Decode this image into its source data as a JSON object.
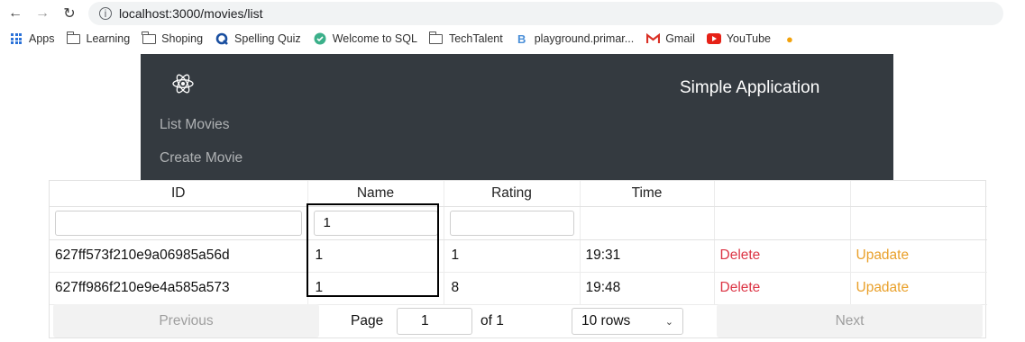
{
  "browser": {
    "url": "localhost:3000/movies/list",
    "bookmarks": [
      {
        "label": "Apps",
        "icon": "apps-grid-icon"
      },
      {
        "label": "Learning",
        "icon": "folder-icon"
      },
      {
        "label": "Shoping",
        "icon": "folder-icon"
      },
      {
        "label": "Spelling Quiz",
        "icon": "q-icon"
      },
      {
        "label": "Welcome to SQL",
        "icon": "sql-icon"
      },
      {
        "label": "TechTalent",
        "icon": "folder-icon"
      },
      {
        "label": "playground.primar...",
        "icon": "b-icon"
      },
      {
        "label": "Gmail",
        "icon": "gmail-icon"
      },
      {
        "label": "YouTube",
        "icon": "youtube-icon"
      }
    ]
  },
  "nav": {
    "brand": "Simple Application",
    "links": [
      "List Movies",
      "Create Movie"
    ],
    "bg_color": "#343a40"
  },
  "table": {
    "headers": [
      "ID",
      "Name",
      "Rating",
      "Time",
      "",
      ""
    ],
    "filters": {
      "id": "",
      "name": "1",
      "rating": ""
    },
    "rows": [
      {
        "id": "627ff573f210e9a06985a56d",
        "name": "1",
        "rating": "1",
        "time": "19:31",
        "delete": "Delete",
        "update": "Upadate"
      },
      {
        "id": "627ff986f210e9e4a585a573",
        "name": "1",
        "rating": "8",
        "time": "19:48",
        "delete": "Delete",
        "update": "Upadate"
      }
    ]
  },
  "pagination": {
    "previous": "Previous",
    "page_label": "Page",
    "page_value": "1",
    "of_label": "of 1",
    "rows_selected": "10 rows",
    "next": "Next"
  },
  "colors": {
    "delete": "#dc3545",
    "update": "#e9a02a"
  }
}
